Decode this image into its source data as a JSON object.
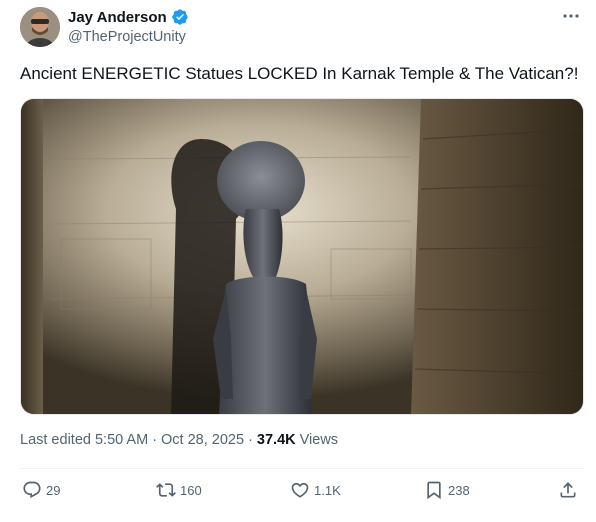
{
  "author": {
    "display_name": "Jay Anderson",
    "handle": "@TheProjectUnity",
    "verified_icon": "verified-badge-icon"
  },
  "tweet": {
    "text": "Ancient ENERGETIC Statues LOCKED In Karnak Temple & The Vatican?!"
  },
  "meta": {
    "edited_label": "Last edited",
    "time": "5:50 AM",
    "dot1": "·",
    "date": "Oct 28, 2025",
    "dot2": "·",
    "views_count": "37.4K",
    "views_label": "Views"
  },
  "actions": {
    "replies": "29",
    "reposts": "160",
    "likes": "1.1K",
    "bookmarks": "238"
  },
  "colors": {
    "text_primary": "#0f1419",
    "text_secondary": "#536471",
    "verified": "#1d9bf0"
  }
}
